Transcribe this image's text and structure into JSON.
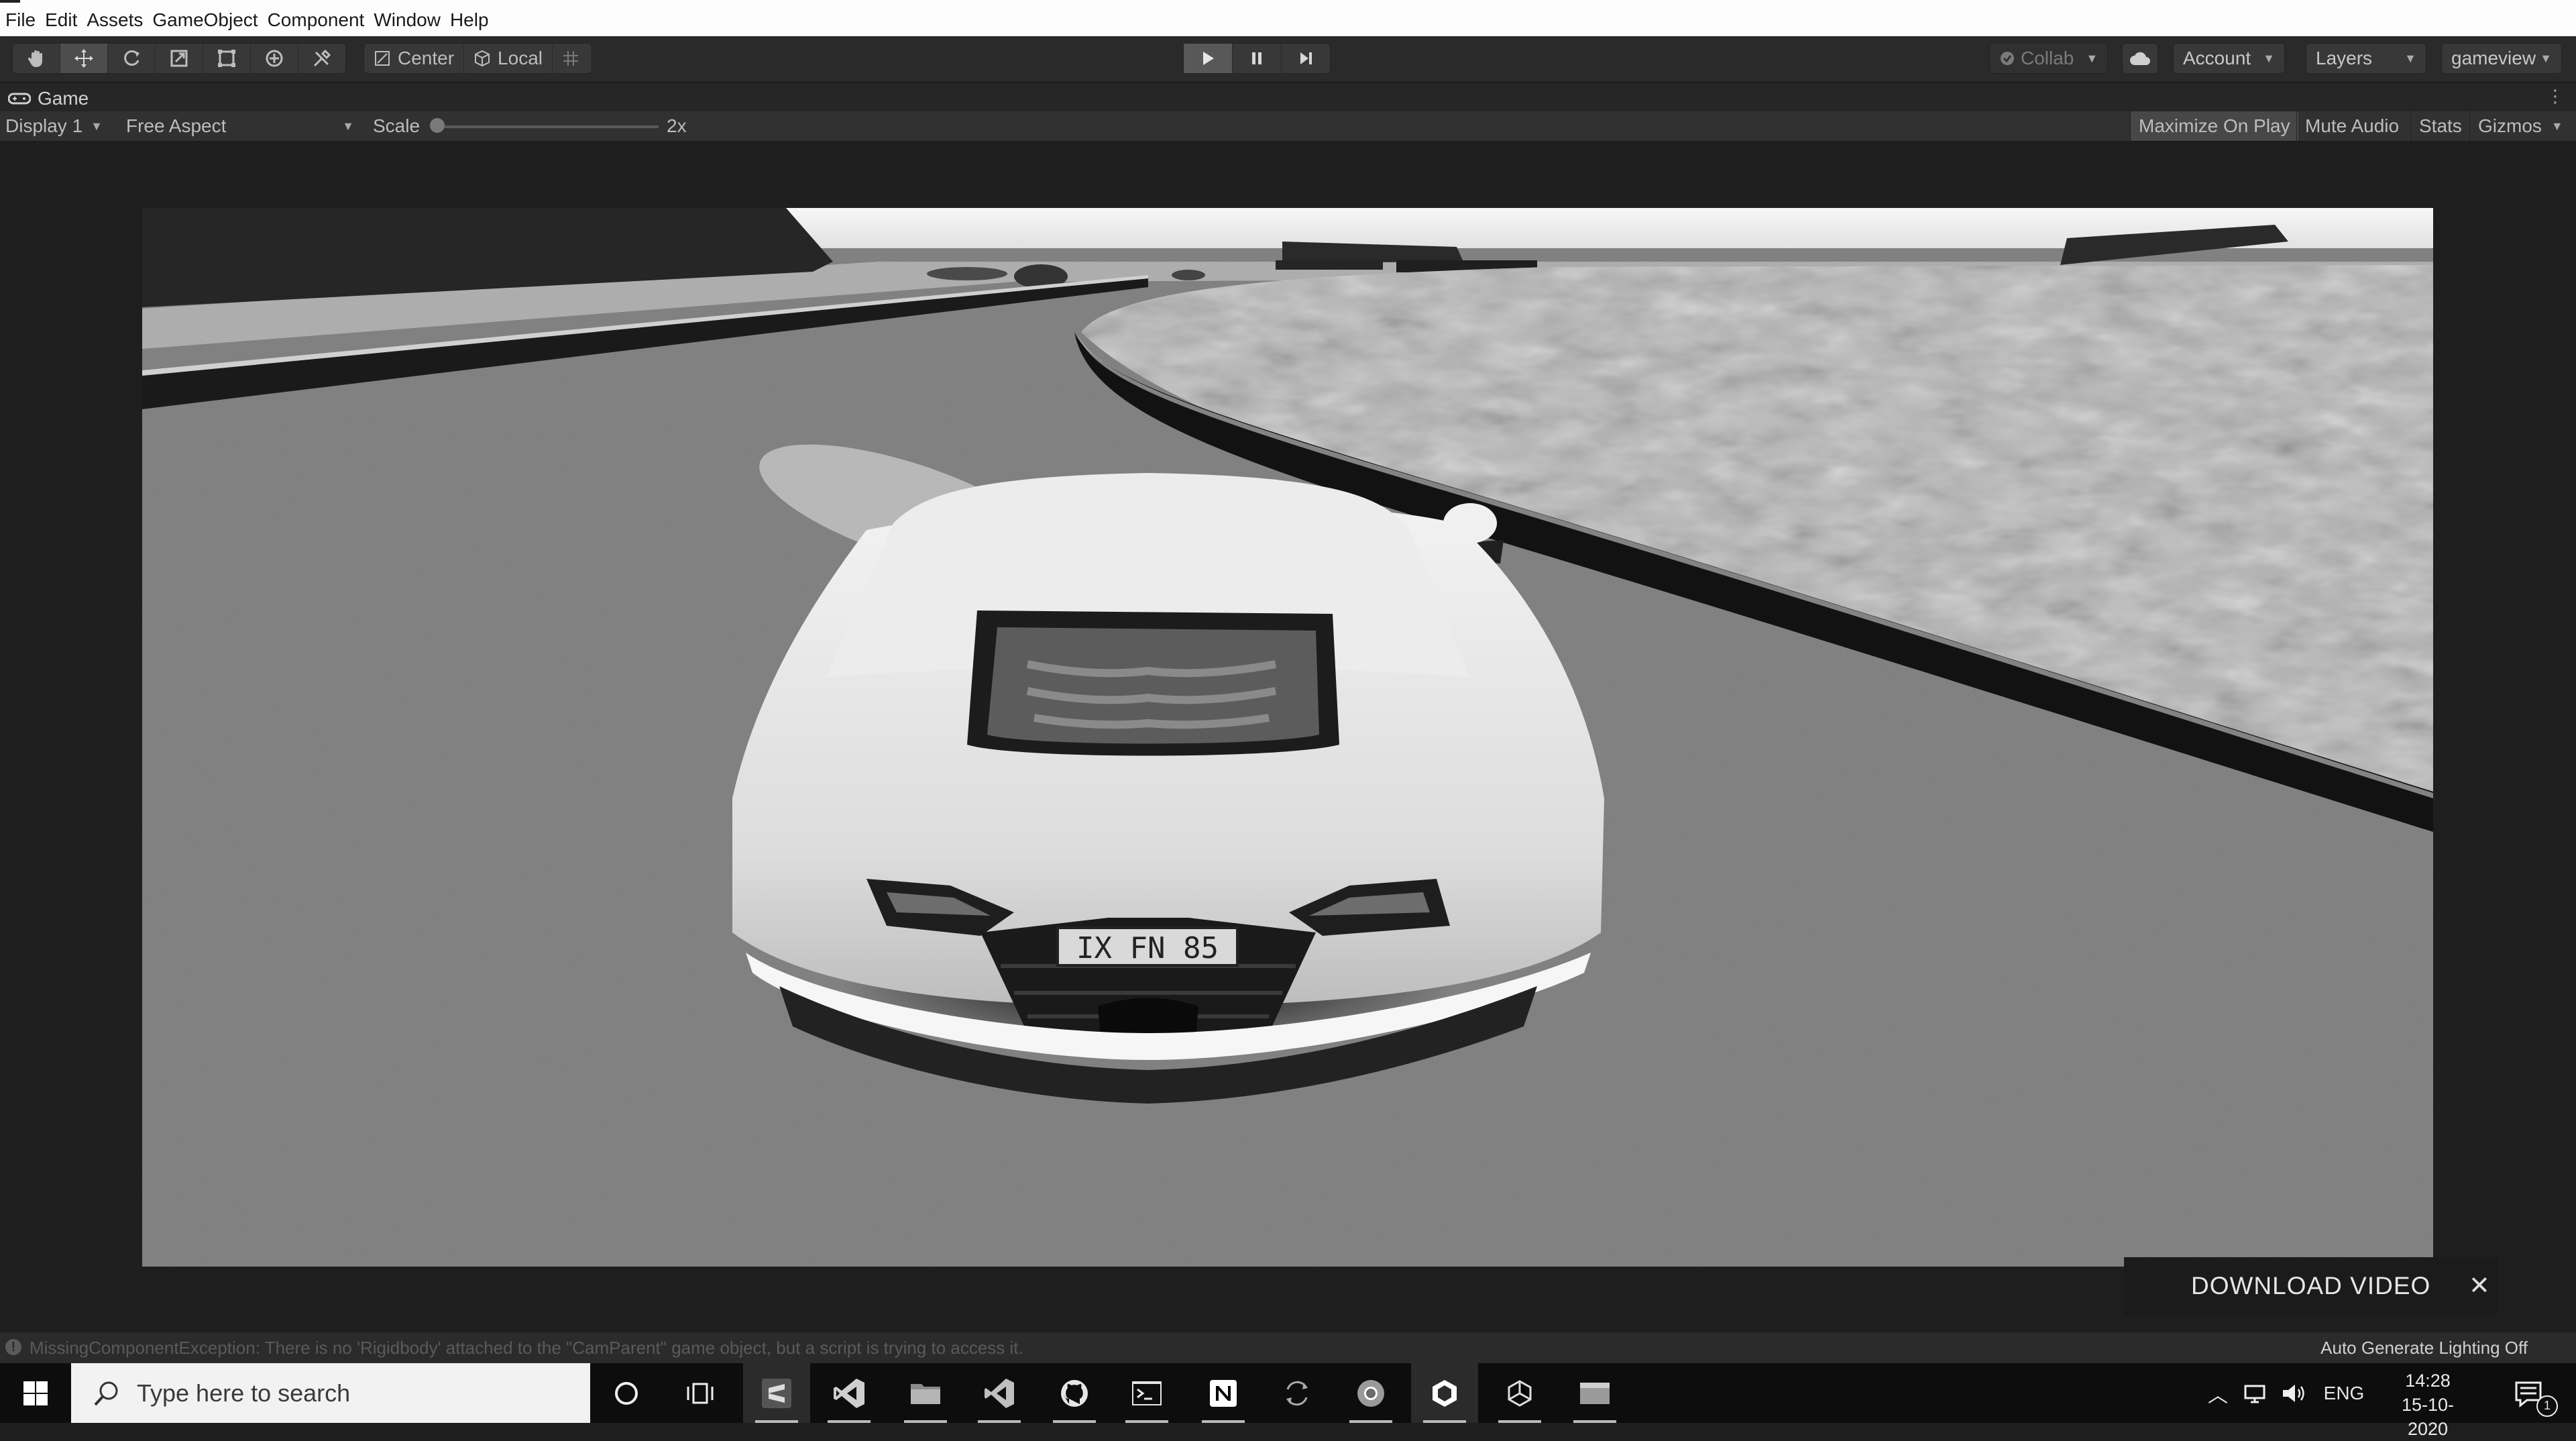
{
  "menubar": {
    "items": [
      "File",
      "Edit",
      "Assets",
      "GameObject",
      "Component",
      "Window",
      "Help"
    ]
  },
  "toolbar": {
    "tools": [
      "hand-tool-icon",
      "move-tool-icon",
      "rotate-tool-icon",
      "scale-tool-icon",
      "rect-tool-icon",
      "transform-tool-icon",
      "custom-tool-icon"
    ],
    "pivot": "Center",
    "space": "Local",
    "collab": "Collab",
    "account": "Account",
    "layers": "Layers",
    "layout": "gameview"
  },
  "game_tab": {
    "label": "Game"
  },
  "game_bar": {
    "display": "Display 1",
    "aspect": "Free Aspect",
    "scale_label": "Scale",
    "scale_value": "2x",
    "scale_level": 0.0,
    "maximize": "Maximize On Play",
    "mute": "Mute Audio",
    "stats": "Stats",
    "gizmos": "Gizmos"
  },
  "scene": {
    "plate": "IX FN 85"
  },
  "download": {
    "label": "DOWNLOAD VIDEO"
  },
  "status": {
    "message": "MissingComponentException: There is no 'Rigidbody' attached to the \"CamParent\" game object, but a script is trying to access it.",
    "lighting": "Auto Generate Lighting Off"
  },
  "taskbar": {
    "search_placeholder": "Type here to search",
    "lang": "ENG",
    "time": "14:28",
    "date": "15-10-2020",
    "notifications": "1"
  }
}
